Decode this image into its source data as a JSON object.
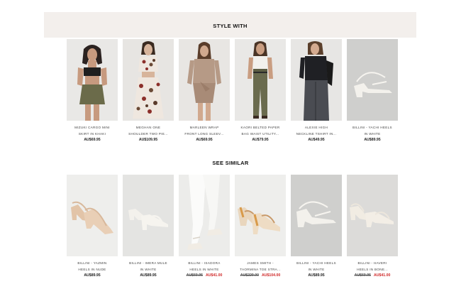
{
  "style_with": {
    "title": "STYLE WITH",
    "products": [
      {
        "name_line1": "MIZUKI CARGO MINI",
        "name_line2": "SKIRT IN KHAKI",
        "price": "AU$69.95"
      },
      {
        "name_line1": "MEGHAN ONE",
        "name_line2": "SHOULDER TWO PIE...",
        "price": "AU$109.95"
      },
      {
        "name_line1": "MARLEEN WRAP",
        "name_line2": "FRONT LONG SLEEV...",
        "price": "AU$69.95"
      },
      {
        "name_line1": "KAORI BELTED PAPER",
        "name_line2": "BAG WAIST UTILITY...",
        "price": "AU$79.95"
      },
      {
        "name_line1": "ALEXIE HIGH",
        "name_line2": "NECKLINE TSHIRT IN...",
        "price": "AU$49.95"
      },
      {
        "name_line1": "BILLINI - YACHI HEELS",
        "name_line2": "IN WHITE",
        "price": "AU$89.95"
      }
    ]
  },
  "see_similar": {
    "title": "SEE SIMILAR",
    "products": [
      {
        "name_line1": "BILLINI - YAZMIN",
        "name_line2": "HEELS IN NUDE",
        "price": "AU$89.95",
        "old_price": "",
        "sale_price": ""
      },
      {
        "name_line1": "BILLINI - IMERA MULE",
        "name_line2": "IN WHITE",
        "price": "AU$89.95",
        "old_price": "",
        "sale_price": ""
      },
      {
        "name_line1": "BILLINI - ISADORA",
        "name_line2": "HEELS IN WHITE",
        "price": "",
        "old_price": "AU$69.95",
        "sale_price": "AU$41.00"
      },
      {
        "name_line1": "JAMES SMITH -",
        "name_line2": "TAORMINA TOE STRA...",
        "price": "",
        "old_price": "AU$229.00",
        "sale_price": "AU$104.00"
      },
      {
        "name_line1": "BILLINI - YACHI HEELS",
        "name_line2": "IN WHITE",
        "price": "AU$89.95",
        "old_price": "",
        "sale_price": ""
      },
      {
        "name_line1": "BILLINI - HAVERI",
        "name_line2": "HEELS IN BONE...",
        "price": "",
        "old_price": "AU$69.95",
        "sale_price": "AU$41.00"
      }
    ]
  },
  "colors": {
    "style_with_band": "#f3efec",
    "sale_price": "#d02a2a",
    "thumb_bg": "#e6e6e4"
  }
}
